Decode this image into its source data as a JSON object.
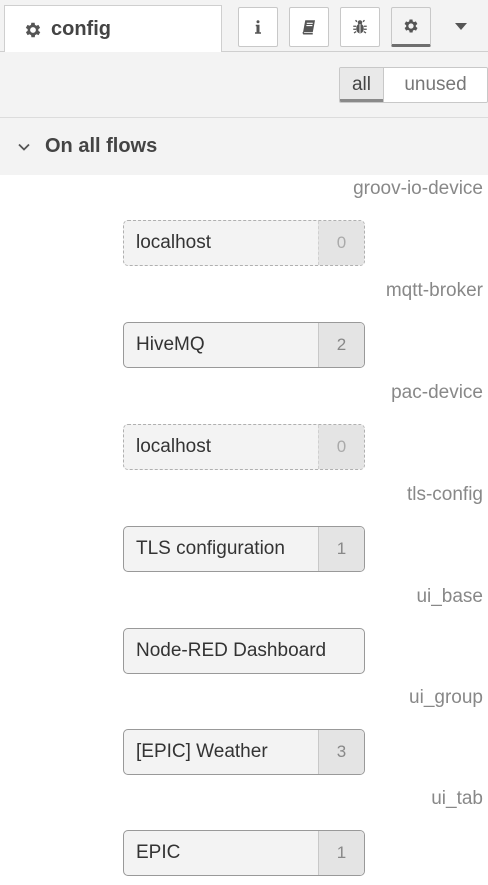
{
  "tabbar": {
    "tab_label": "config",
    "buttons": [
      {
        "icon": "info-icon"
      },
      {
        "icon": "book-icon"
      },
      {
        "icon": "bug-icon"
      },
      {
        "icon": "gear-icon"
      }
    ]
  },
  "filter": {
    "all_label": "all",
    "unused_label": "unused",
    "selected": "all"
  },
  "section": {
    "title": "On all flows"
  },
  "config_types": [
    {
      "type": "groov-io-device",
      "node": {
        "label": "localhost",
        "count": "0",
        "unused": true
      }
    },
    {
      "type": "mqtt-broker",
      "node": {
        "label": "HiveMQ",
        "count": "2",
        "unused": false
      }
    },
    {
      "type": "pac-device",
      "node": {
        "label": "localhost",
        "count": "0",
        "unused": true
      }
    },
    {
      "type": "tls-config",
      "node": {
        "label": "TLS configuration",
        "count": "1",
        "unused": false
      }
    },
    {
      "type": "ui_base",
      "node": {
        "label": "Node-RED Dashboard",
        "count": "",
        "unused": false
      }
    },
    {
      "type": "ui_group",
      "node": {
        "label": "[EPIC] Weather",
        "count": "3",
        "unused": false
      }
    },
    {
      "type": "ui_tab",
      "node": {
        "label": "EPIC",
        "count": "1",
        "unused": false
      }
    }
  ]
}
